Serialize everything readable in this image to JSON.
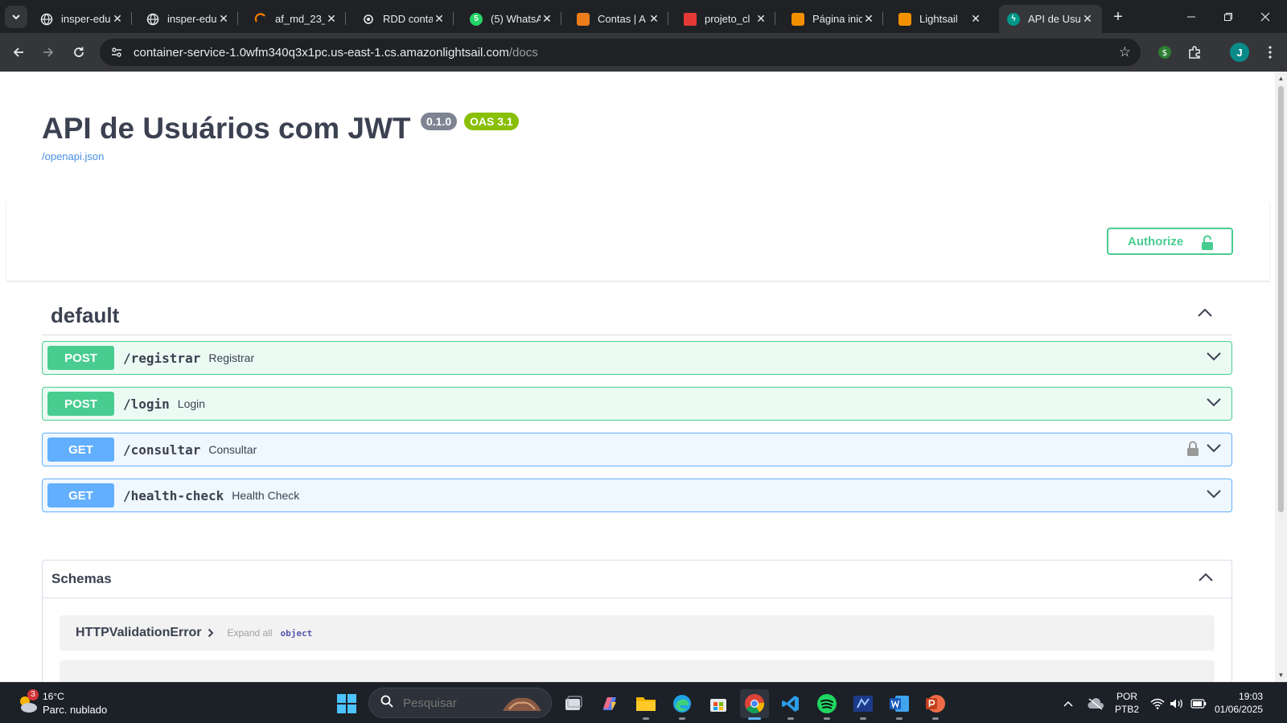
{
  "browser": {
    "tabs": [
      {
        "title": "insper-edu",
        "icon": "globe-icon"
      },
      {
        "title": "insper-edu",
        "icon": "globe-icon"
      },
      {
        "title": "af_md_23_",
        "icon": "loading-icon"
      },
      {
        "title": "RDD conta",
        "icon": "openai-icon"
      },
      {
        "title": "(5) WhatsA",
        "icon": "whatsapp-icon"
      },
      {
        "title": "Contas | A",
        "icon": "aws-cube-icon"
      },
      {
        "title": "projeto_cl",
        "icon": "pdf-icon"
      },
      {
        "title": "Página inic",
        "icon": "lightsail-icon"
      },
      {
        "title": "Lightsail",
        "icon": "lightsail-icon"
      },
      {
        "title": "API de Usu",
        "icon": "fastapi-icon"
      }
    ],
    "url_host": "container-service-1.0wfm340q3x1pc.us-east-1.cs.amazonlightsail.com",
    "url_path": "/docs"
  },
  "api": {
    "title": "API de Usuários com JWT",
    "version": "0.1.0",
    "oas": "OAS 3.1",
    "spec_link": "/openapi.json",
    "authorize_label": "Authorize"
  },
  "tag": {
    "name": "default",
    "operations": [
      {
        "method": "POST",
        "path": "/registrar",
        "summary": "Registrar"
      },
      {
        "method": "POST",
        "path": "/login",
        "summary": "Login"
      },
      {
        "method": "GET",
        "path": "/consultar",
        "summary": "Consultar"
      },
      {
        "method": "GET",
        "path": "/health-check",
        "summary": "Health Check"
      }
    ]
  },
  "schemas": {
    "title": "Schemas",
    "models": [
      {
        "name": "HTTPValidationError",
        "expand": "Expand all",
        "type": "object"
      }
    ]
  },
  "taskbar": {
    "weather_temp": "16°C",
    "weather_desc": "Parc. nublado",
    "weather_badge": "3",
    "search_placeholder": "Pesquisar",
    "lang_line1": "POR",
    "lang_line2": "PTB2",
    "time": "19:03",
    "date": "01/06/2025"
  },
  "colors": {
    "post": "#49cc90",
    "get": "#61affe",
    "title": "#3b4151",
    "link": "#4990e2",
    "oas_badge": "#89bf04",
    "version_badge": "#7d8492"
  }
}
